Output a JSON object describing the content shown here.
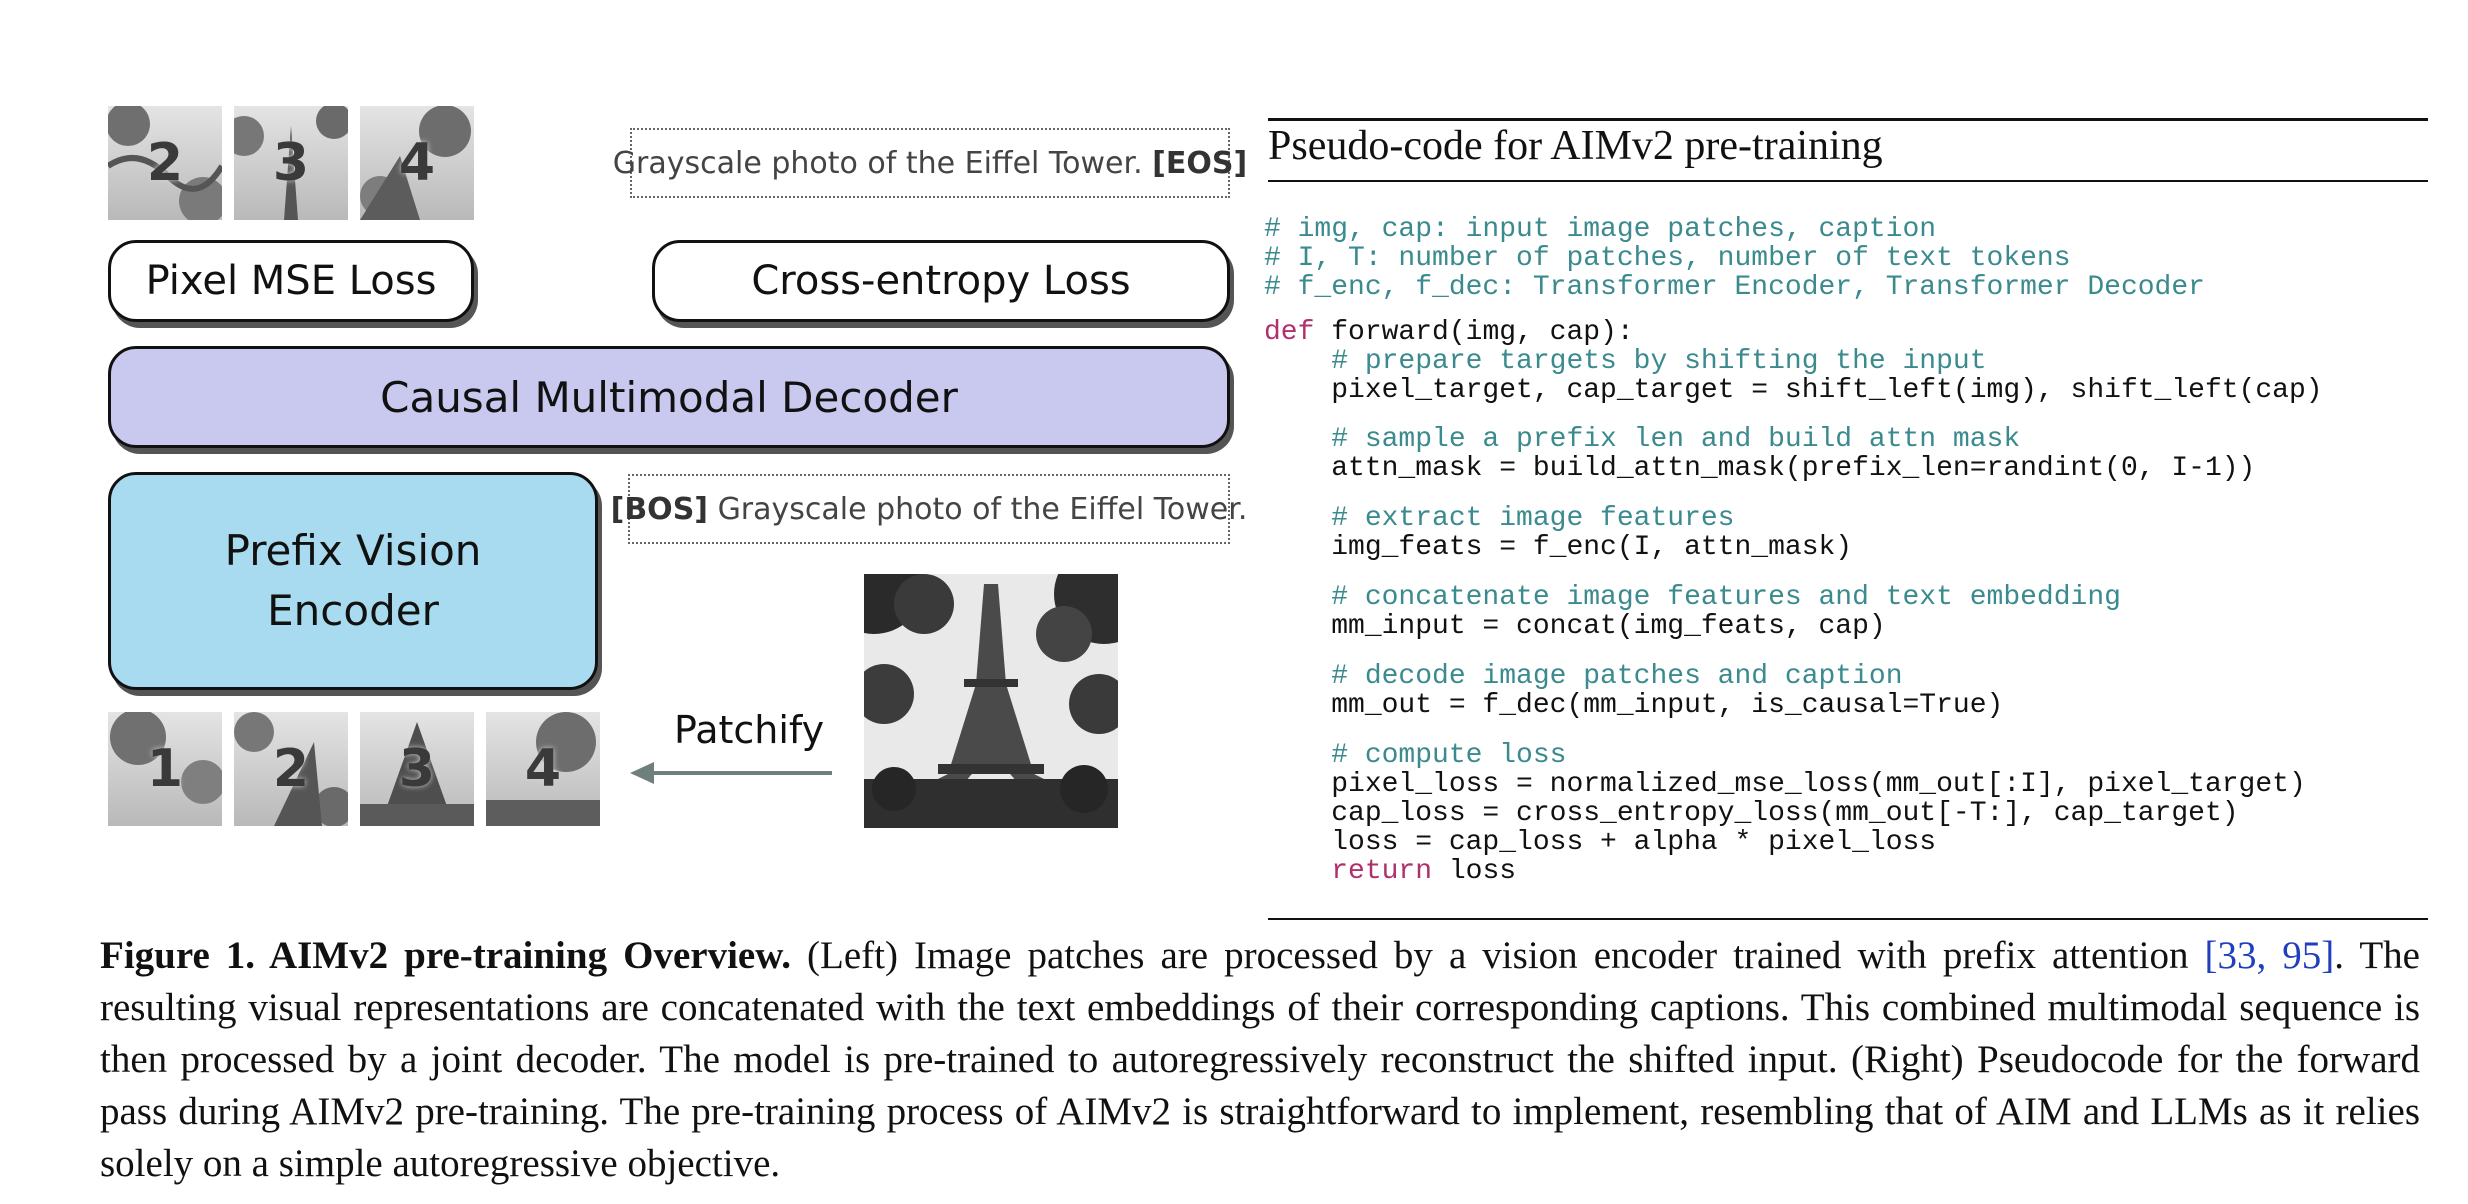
{
  "left": {
    "target_patches": [
      "2",
      "3",
      "4"
    ],
    "input_patches": [
      "1",
      "2",
      "3",
      "4"
    ],
    "output_caption": {
      "text": "Grayscale photo of the Eiffel Tower.",
      "token": "[EOS]"
    },
    "input_caption": {
      "token": "[BOS]",
      "text": "Grayscale photo of the Eiffel Tower."
    },
    "pixel_loss_label": "Pixel MSE Loss",
    "ce_loss_label": "Cross-entropy Loss",
    "decoder_label": "Causal Multimodal Decoder",
    "encoder_label_line1": "Prefix Vision",
    "encoder_label_line2": "Encoder",
    "patchify_label": "Patchify",
    "colors": {
      "decoder_fill": "#c9c8ef",
      "encoder_fill": "#a8dbef",
      "arrow": "#6f7f7d"
    }
  },
  "right": {
    "title": "Pseudo-code for AIMv2 pre-training",
    "code": {
      "c1": "# img, cap: input image patches, caption",
      "c2": "# I, T: number of patches, number of text tokens",
      "c3": "# f_enc, f_dec: Transformer Encoder, Transformer Decoder",
      "def_kw": "def",
      "def_rest": " forward(img, cap):",
      "c4": "    # prepare targets by shifting the input",
      "l1": "    pixel_target, cap_target = shift_left(img), shift_left(cap)",
      "c5": "    # sample a prefix len and build attn mask",
      "l2": "    attn_mask = build_attn_mask(prefix_len=randint(0, I-1))",
      "c6": "    # extract image features",
      "l3": "    img_feats = f_enc(I, attn_mask)",
      "c7": "    # concatenate image features and text embedding",
      "l4": "    mm_input = concat(img_feats, cap)",
      "c8": "    # decode image patches and caption",
      "l5": "    mm_out = f_dec(mm_input, is_causal=True)",
      "c9": "    # compute loss",
      "l6": "    pixel_loss = normalized_mse_loss(mm_out[:I], pixel_target)",
      "l7": "    cap_loss = cross_entropy_loss(mm_out[-T:], cap_target)",
      "l8": "    loss = cap_loss + alpha * pixel_loss",
      "ret_kw": "    return",
      "ret_rest": " loss"
    }
  },
  "caption": {
    "label": "Figure 1. AIMv2 pre-training Overview.",
    "part1": " (Left) Image patches are processed by a vision encoder trained with prefix attention ",
    "ref": "[33, 95]",
    "part2": ". The resulting visual representations are concatenated with the text embeddings of their corresponding captions. This combined multimodal sequence is then processed by a joint decoder. The model is pre-trained to autoregressively reconstruct the shifted input. (Right) Pseudocode for the forward pass during AIMv2 pre-training. The pre-training process of AIMv2 is straightforward to implement, resembling that of AIM and LLMs as it relies solely on a simple autoregressive objective."
  }
}
